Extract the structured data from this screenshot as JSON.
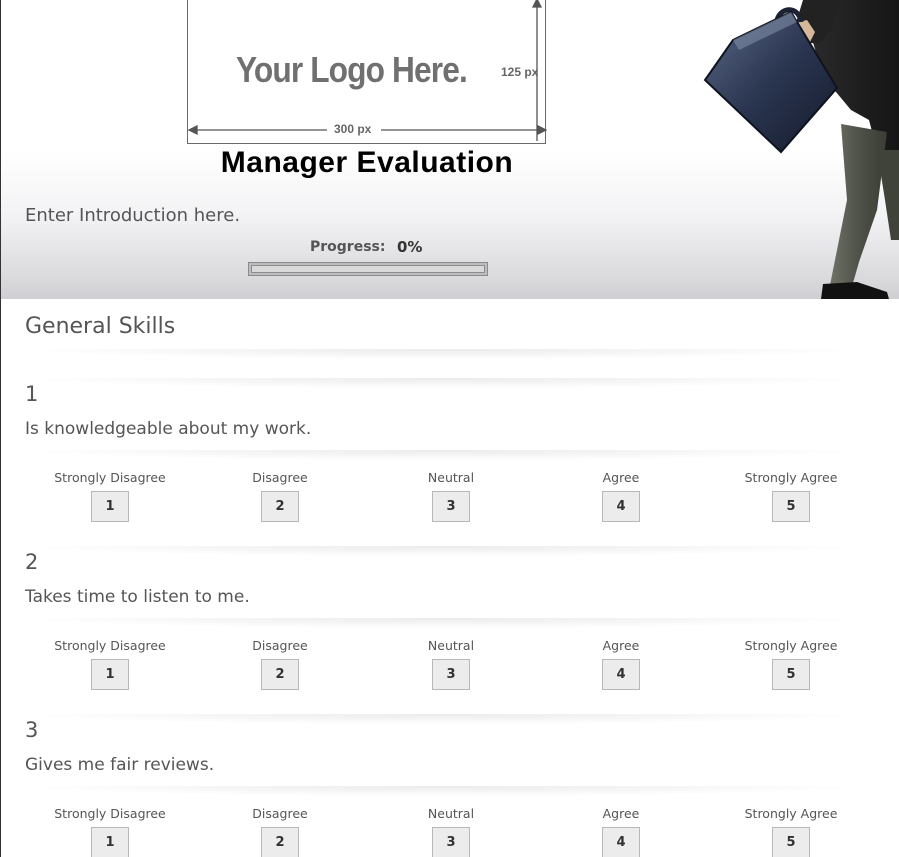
{
  "header": {
    "logo": {
      "text": "Your Logo Here.",
      "height_label": "125 px",
      "width_label": "300 px"
    },
    "title": "Manager Evaluation",
    "intro": "Enter Introduction here.",
    "progress": {
      "label": "Progress:",
      "value_text": "0%",
      "value": 0
    }
  },
  "section": {
    "title": "General Skills"
  },
  "scale_labels": [
    "Strongly Disagree",
    "Disagree",
    "Neutral",
    "Agree",
    "Strongly Agree"
  ],
  "scale_values": [
    "1",
    "2",
    "3",
    "4",
    "5"
  ],
  "questions": [
    {
      "number": "1",
      "text": "Is knowledgeable about my work."
    },
    {
      "number": "2",
      "text": "Takes time to listen to me."
    },
    {
      "number": "3",
      "text": "Gives me fair reviews."
    }
  ],
  "colors": {
    "title": "#000000",
    "text": "#555555",
    "button_bg": "#ececec",
    "button_border": "#b8b8b8",
    "progress_fill": "#4a7ab5"
  }
}
